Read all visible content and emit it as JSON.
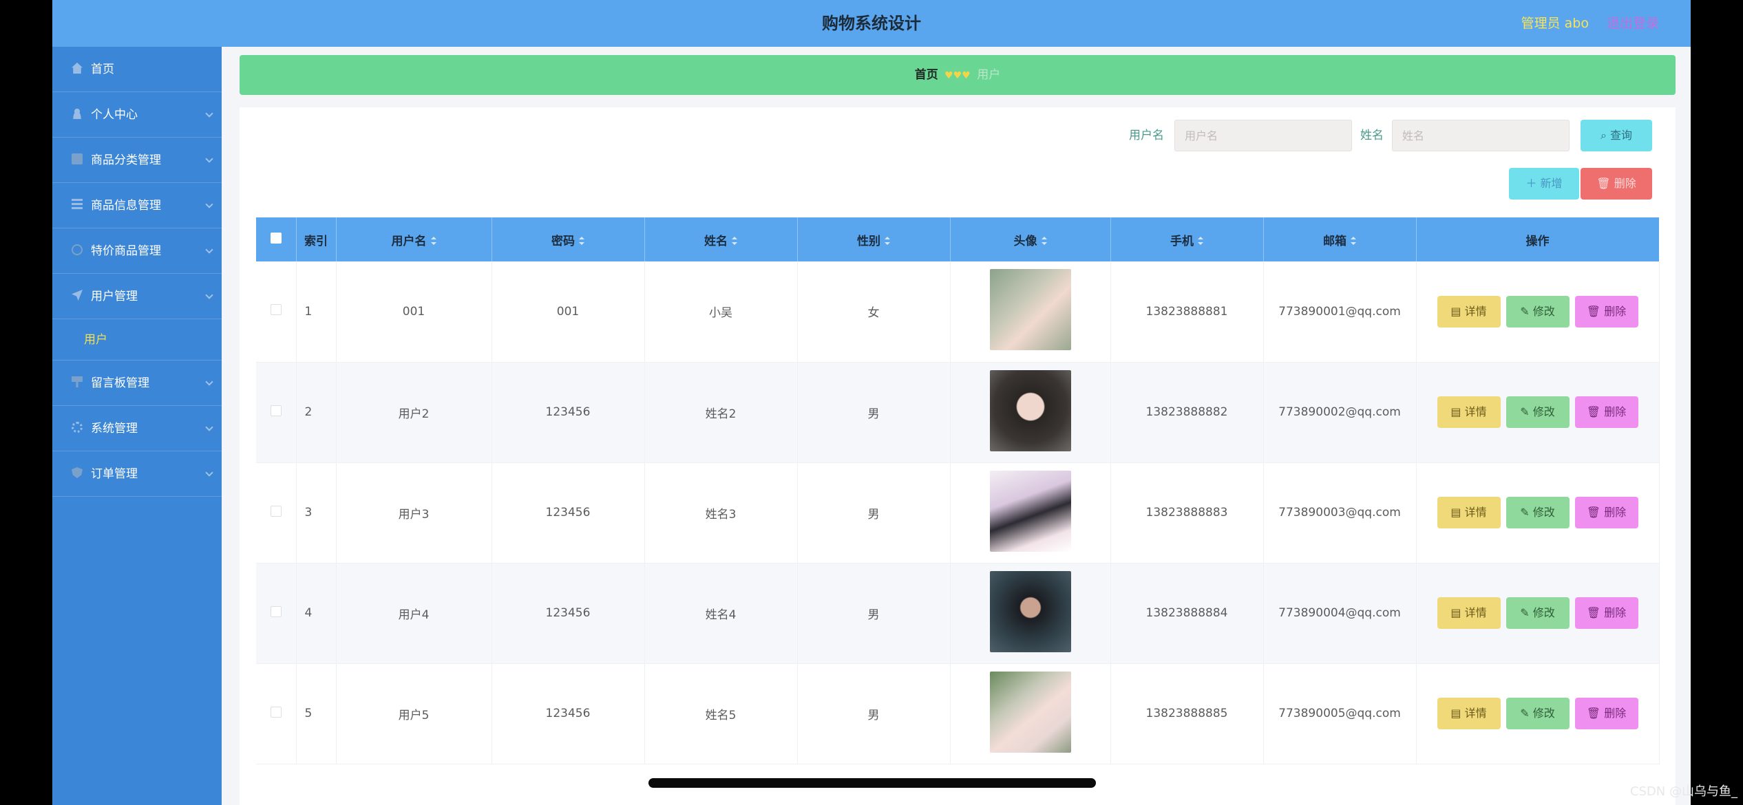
{
  "header": {
    "title": "购物系统设计",
    "user": "管理员 abo",
    "logout": "退出登录"
  },
  "sidebar": {
    "items": [
      {
        "label": "首页",
        "icon": "home-icon"
      },
      {
        "label": "个人中心",
        "icon": "user-icon"
      },
      {
        "label": "商品分类管理",
        "icon": "box-icon"
      },
      {
        "label": "商品信息管理",
        "icon": "list-icon"
      },
      {
        "label": "特价商品管理",
        "icon": "circle-icon"
      },
      {
        "label": "用户管理",
        "icon": "send-icon",
        "expanded": true,
        "sub": [
          "用户"
        ]
      },
      {
        "label": "留言板管理",
        "icon": "board-icon"
      },
      {
        "label": "系统管理",
        "icon": "gear-icon"
      },
      {
        "label": "订单管理",
        "icon": "shield-icon"
      }
    ]
  },
  "breadcrumb": {
    "home": "首页",
    "separator": "♥♥♥",
    "current": "用户"
  },
  "search": {
    "username_label": "用户名",
    "username_placeholder": "用户名",
    "name_label": "姓名",
    "name_placeholder": "姓名",
    "query_button": "查询"
  },
  "toolbar": {
    "add_button": "新增",
    "delete_button": "删除"
  },
  "table": {
    "columns": [
      "索引",
      "用户名",
      "密码",
      "姓名",
      "性别",
      "头像",
      "手机",
      "邮箱",
      "操作"
    ],
    "rows": [
      {
        "index": "1",
        "username": "001",
        "password": "001",
        "name": "小吴",
        "gender": "女",
        "phone": "13823888881",
        "email": "773890001@qq.com"
      },
      {
        "index": "2",
        "username": "用户2",
        "password": "123456",
        "name": "姓名2",
        "gender": "男",
        "phone": "13823888882",
        "email": "773890002@qq.com"
      },
      {
        "index": "3",
        "username": "用户3",
        "password": "123456",
        "name": "姓名3",
        "gender": "男",
        "phone": "13823888883",
        "email": "773890003@qq.com"
      },
      {
        "index": "4",
        "username": "用户4",
        "password": "123456",
        "name": "姓名4",
        "gender": "男",
        "phone": "13823888884",
        "email": "773890004@qq.com"
      },
      {
        "index": "5",
        "username": "用户5",
        "password": "123456",
        "name": "姓名5",
        "gender": "男",
        "phone": "13823888885",
        "email": "773890005@qq.com"
      }
    ],
    "actions": {
      "detail": "详情",
      "edit": "修改",
      "delete": "删除"
    }
  },
  "colors": {
    "header": "#5aa6ee",
    "sidebar": "#3c86d8",
    "breadcrumb": "#6ad694",
    "accent_yellow": "#f3df55"
  },
  "watermark": "CSDN @山乌与鱼_"
}
